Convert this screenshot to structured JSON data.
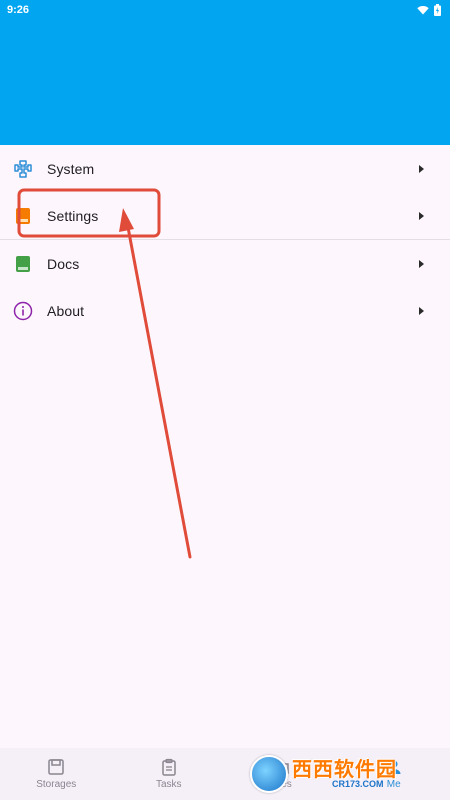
{
  "status_bar": {
    "time": "9:26"
  },
  "colors": {
    "header": "#02a6f0",
    "annotation": "#e04b3a"
  },
  "menu": {
    "items": [
      {
        "label": "System",
        "icon": "puzzle-icon",
        "icon_color": "#2b8fd6"
      },
      {
        "label": "Settings",
        "icon": "settings-book-icon",
        "icon_color": "#f57c00"
      },
      {
        "label": "Docs",
        "icon": "book-icon",
        "icon_color": "#43a047"
      },
      {
        "label": "About",
        "icon": "info-icon",
        "icon_color": "#8e24aa"
      }
    ]
  },
  "bottom_nav": {
    "items": [
      {
        "label": "Storages",
        "icon": "storage-icon"
      },
      {
        "label": "Tasks",
        "icon": "clipboard-icon"
      },
      {
        "label": "Files",
        "icon": "folder-icon"
      },
      {
        "label": "Me",
        "icon": "person-icon"
      }
    ],
    "active_index": 3
  },
  "watermark": {
    "main": "西西软件园",
    "sub": "CR173.COM"
  }
}
